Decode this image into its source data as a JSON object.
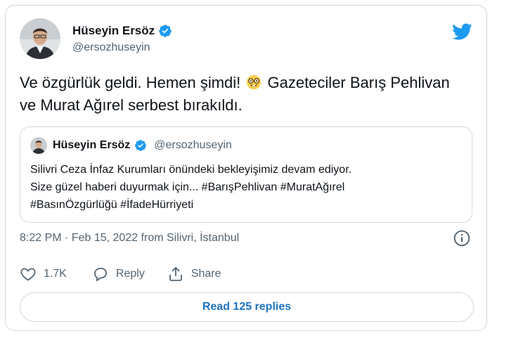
{
  "author": {
    "name": "Hüseyin Ersöz",
    "handle": "@ersozhuseyin"
  },
  "tweet": {
    "text_part1": "Ve özgürlük geldi. Hemen şimdi! ",
    "text_part2": " Gazeteciler Barış Pehlivan ve Murat Ağırel serbest bırakıldı.",
    "emoji_icon": "nerd-face-emoji"
  },
  "quoted_tweet": {
    "name": "Hüseyin Ersöz",
    "handle": "@ersozhuseyin",
    "line1": "Silivri Ceza İnfaz Kurumları önündeki bekleyişimiz devam ediyor.",
    "line2": "Size güzel haberi duyurmak için... #BarışPehlivan #MuratAğırel",
    "line3": "#BasınÖzgürlüğü #İfadeHürriyeti"
  },
  "meta": {
    "time": "8:22 PM",
    "separator": " · ",
    "date": "Feb 15, 2022",
    "source": " from Silivri, İstanbul"
  },
  "actions": {
    "likes": "1.7K",
    "reply_label": "Reply",
    "share_label": "Share"
  },
  "read_replies_label": "Read 125 replies",
  "colors": {
    "twitter_blue": "#1d9bf0",
    "link_blue": "#1d74c4",
    "border": "#cfd9de",
    "secondary_text": "#536471"
  }
}
